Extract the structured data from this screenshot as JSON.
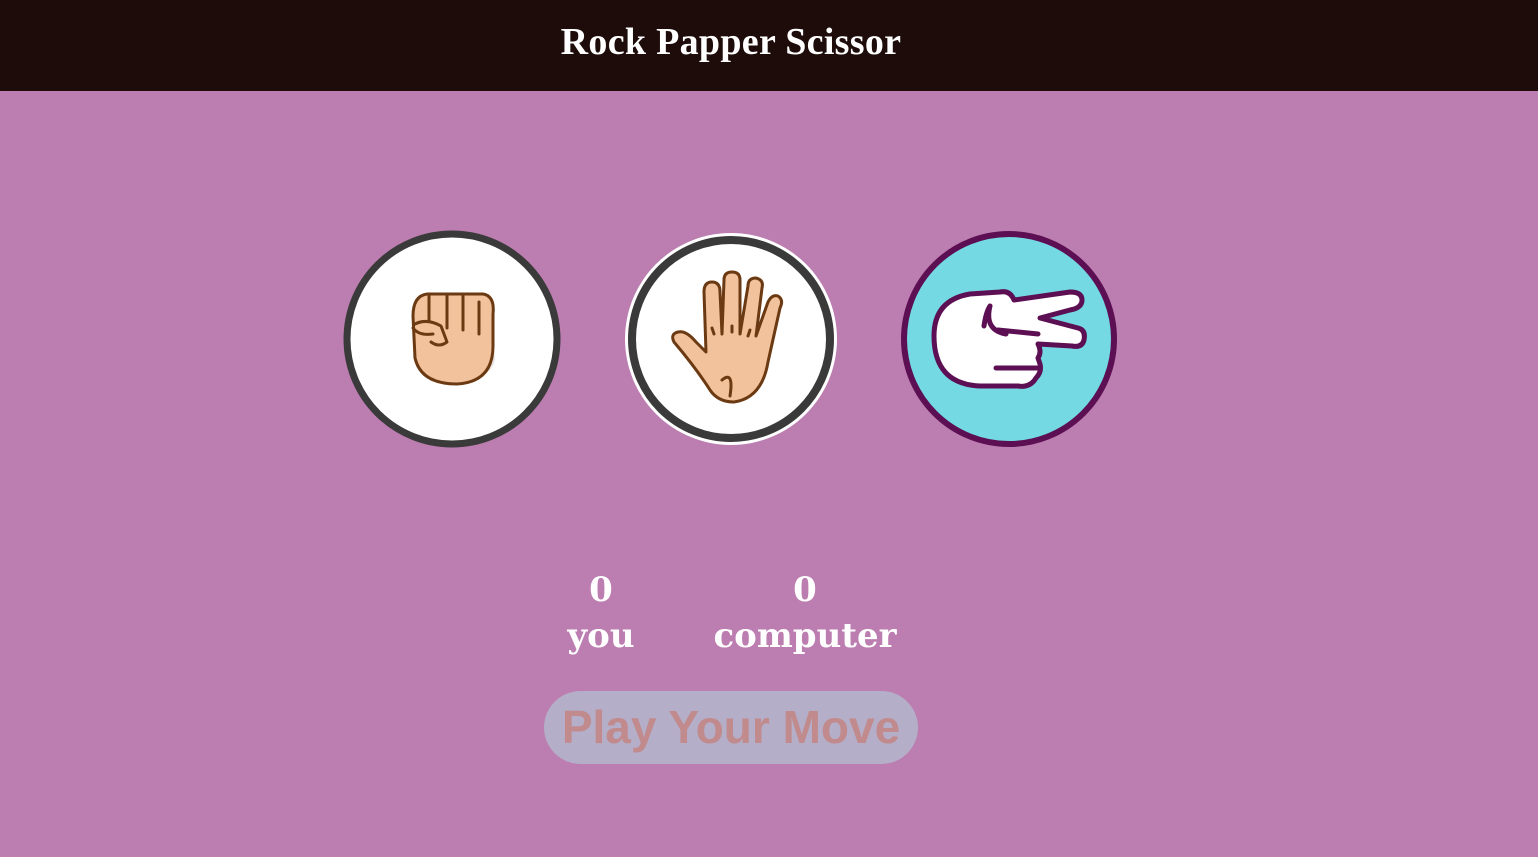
{
  "header": {
    "title": "Rock Papper Scissor"
  },
  "choices": [
    {
      "id": "rock",
      "icon": "fist-icon"
    },
    {
      "id": "paper",
      "icon": "open-hand-icon"
    },
    {
      "id": "scissor",
      "icon": "two-finger-hand-icon"
    }
  ],
  "scoreboard": {
    "you": {
      "score": "0",
      "label": "you"
    },
    "computer": {
      "score": "0",
      "label": "computer"
    }
  },
  "message": {
    "text": "Play Your Move"
  },
  "colors": {
    "background": "#bc7db0",
    "header": "#1e0c0b",
    "scissor_bg": "#74d9e2",
    "scissor_stroke": "#5c0f52",
    "skin": "#f2c29c",
    "skin_stroke": "#6b3a12",
    "ring": "#3a3a3a",
    "message_bg": "#b5aec9",
    "message_text": "#c18a8c"
  }
}
